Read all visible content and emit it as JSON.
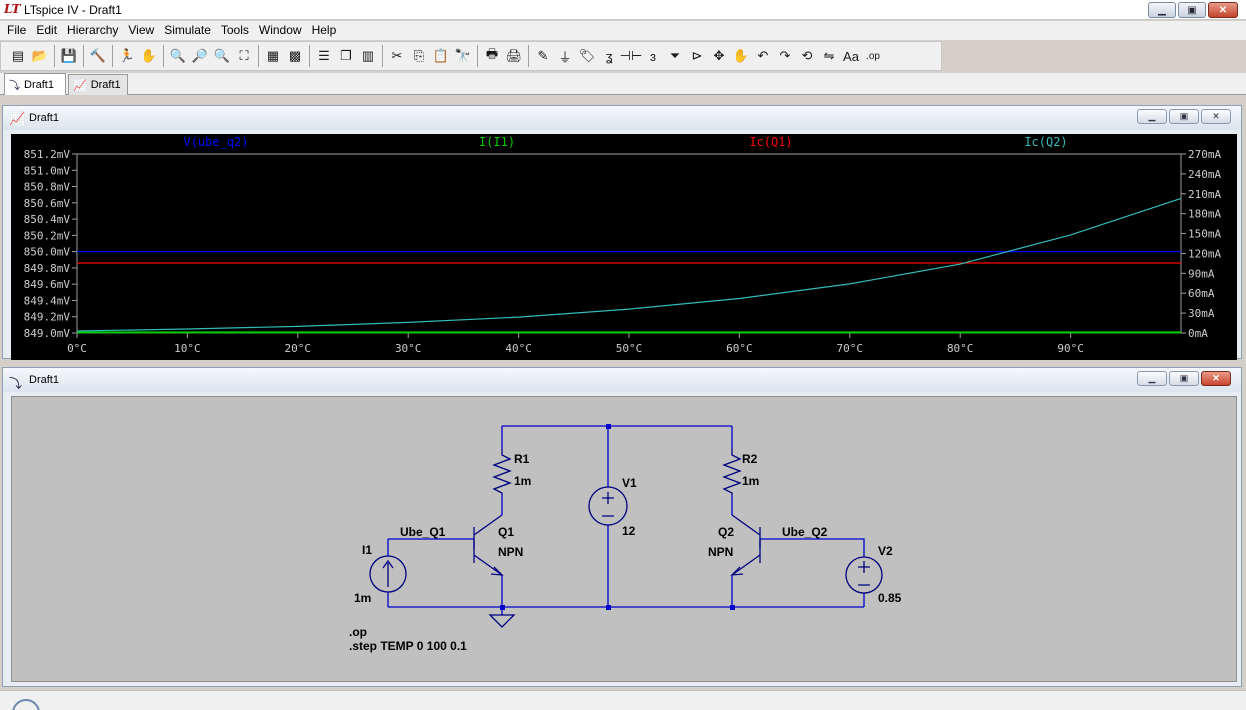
{
  "window": {
    "title": "LTspice IV - Draft1",
    "app_icon": "ltspice-logo-icon",
    "buttons": {
      "minimize": "▁",
      "maximize": "▣",
      "close": "✕"
    }
  },
  "menu": [
    "File",
    "Edit",
    "Hierarchy",
    "View",
    "Simulate",
    "Tools",
    "Window",
    "Help"
  ],
  "toolbar": {
    "tools": [
      {
        "name": "new-schematic",
        "glyph": "▤"
      },
      {
        "name": "open",
        "glyph": "📂"
      },
      {
        "sep": true
      },
      {
        "name": "save",
        "glyph": "💾"
      },
      {
        "sep": true
      },
      {
        "name": "control-panel",
        "glyph": "🔨"
      },
      {
        "sep": true
      },
      {
        "name": "run",
        "glyph": "🏃"
      },
      {
        "name": "halt",
        "glyph": "✋"
      },
      {
        "sep": true
      },
      {
        "name": "zoom-in",
        "glyph": "🔍"
      },
      {
        "name": "pan",
        "glyph": "🔎"
      },
      {
        "name": "zoom-out",
        "glyph": "🔍"
      },
      {
        "name": "zoom-fit",
        "glyph": "⛶"
      },
      {
        "sep": true
      },
      {
        "name": "autorange",
        "glyph": "▦"
      },
      {
        "name": "grid",
        "glyph": "▩"
      },
      {
        "sep": true
      },
      {
        "name": "tile-horizontal",
        "glyph": "☰"
      },
      {
        "name": "cascade",
        "glyph": "❐"
      },
      {
        "name": "tile-vertical",
        "glyph": "▥"
      },
      {
        "sep": true
      },
      {
        "name": "cut",
        "glyph": "✂"
      },
      {
        "name": "copy",
        "glyph": "⎘"
      },
      {
        "name": "paste",
        "glyph": "📋"
      },
      {
        "name": "find",
        "glyph": "🔭"
      },
      {
        "sep": true
      },
      {
        "name": "print-preview",
        "glyph": "🖶"
      },
      {
        "name": "print",
        "glyph": "🖨"
      },
      {
        "sep": true
      },
      {
        "name": "draw-wire",
        "glyph": "✎"
      },
      {
        "name": "ground",
        "glyph": "⏚"
      },
      {
        "name": "label-net",
        "glyph": "🏷"
      },
      {
        "name": "resistor",
        "glyph": "ʓ"
      },
      {
        "name": "capacitor",
        "glyph": "⊣⊢"
      },
      {
        "name": "inductor",
        "glyph": "ɜ"
      },
      {
        "name": "diode",
        "glyph": "⏷"
      },
      {
        "name": "component",
        "glyph": "⊳"
      },
      {
        "name": "move",
        "glyph": "✥"
      },
      {
        "name": "drag",
        "glyph": "✋"
      },
      {
        "name": "undo",
        "glyph": "↶"
      },
      {
        "name": "redo",
        "glyph": "↷"
      },
      {
        "name": "rotate",
        "glyph": "⟲"
      },
      {
        "name": "mirror",
        "glyph": "⇋"
      },
      {
        "name": "text",
        "glyph": "Aa"
      },
      {
        "name": "spice-directive",
        "glyph": ".op"
      }
    ]
  },
  "tabs": [
    {
      "label": "Draft1",
      "kind": "schematic",
      "icon": "schematic-icon"
    },
    {
      "label": "Draft1",
      "kind": "waveform",
      "icon": "waveform-icon"
    }
  ],
  "waveform_window": {
    "title": "Draft1",
    "icon": "waveform-icon",
    "buttons": {
      "minimize": "▁",
      "maximize": "▣",
      "close": "✕"
    }
  },
  "schematic_window": {
    "title": "Draft1",
    "icon": "schematic-icon",
    "buttons": {
      "minimize": "▁",
      "maximize": "▣",
      "close": "✕"
    }
  },
  "colors": {
    "plot_bg": "#000000",
    "axis_text": "#cccccc",
    "trace_vube_q2": "#0000ff",
    "trace_i_i1": "#00cc00",
    "trace_ic_q1": "#ff0000",
    "trace_ic_q2": "#33bbbb",
    "wire": "#0000cc",
    "component": "#000080",
    "schematic_bg": "#c0c0c0"
  },
  "chart_data": {
    "type": "line",
    "x": [
      0,
      10,
      20,
      30,
      40,
      50,
      60,
      70,
      80,
      90,
      100
    ],
    "xlim": [
      0,
      100
    ],
    "x_ticks": [
      "0°C",
      "10°C",
      "20°C",
      "30°C",
      "40°C",
      "50°C",
      "60°C",
      "70°C",
      "80°C",
      "90°C"
    ],
    "y_left_ticks": [
      "851.2mV",
      "851.0mV",
      "850.8mV",
      "850.6mV",
      "850.4mV",
      "850.2mV",
      "850.0mV",
      "849.8mV",
      "849.6mV",
      "849.4mV",
      "849.2mV",
      "849.0mV"
    ],
    "y_left_lim": [
      849.0,
      851.2
    ],
    "y_right_ticks": [
      "270mA",
      "240mA",
      "210mA",
      "180mA",
      "150mA",
      "120mA",
      "90mA",
      "60mA",
      "30mA",
      "0mA"
    ],
    "y_right_lim": [
      0,
      270
    ],
    "grid": false,
    "legend": "top",
    "series": [
      {
        "name": "V(ube_q2)",
        "axis": "left",
        "values": [
          850.0,
          850.0,
          850.0,
          850.0,
          850.0,
          850.0,
          850.0,
          850.0,
          850.0,
          850.0,
          850.0
        ]
      },
      {
        "name": "I(I1)",
        "axis": "right",
        "values": [
          1,
          1,
          1,
          1,
          1,
          1,
          1,
          1,
          1,
          1,
          1
        ]
      },
      {
        "name": "Ic(Q1)",
        "axis": "left",
        "values": [
          849.86,
          849.86,
          849.86,
          849.86,
          849.86,
          849.86,
          849.86,
          849.86,
          849.86,
          849.86,
          849.86
        ]
      },
      {
        "name": "Ic(Q2)",
        "axis": "right",
        "values": [
          3,
          6,
          10,
          16,
          24,
          36,
          52,
          74,
          104,
          148,
          203
        ]
      }
    ]
  },
  "schematic": {
    "R1": {
      "name": "R1",
      "value": "1m"
    },
    "R2": {
      "name": "R2",
      "value": "1m"
    },
    "V1": {
      "name": "V1",
      "value": "12"
    },
    "V2": {
      "name": "V2",
      "value": "0.85"
    },
    "I1": {
      "name": "I1",
      "value": "1m"
    },
    "Q1": {
      "name": "Q1",
      "model": "NPN"
    },
    "Q2": {
      "name": "Q2",
      "model": "NPN"
    },
    "net_ube_q1": "Ube_Q1",
    "net_ube_q2": "Ube_Q2",
    "directive_op": ".op",
    "directive_step": ".step TEMP 0 100 0.1"
  }
}
